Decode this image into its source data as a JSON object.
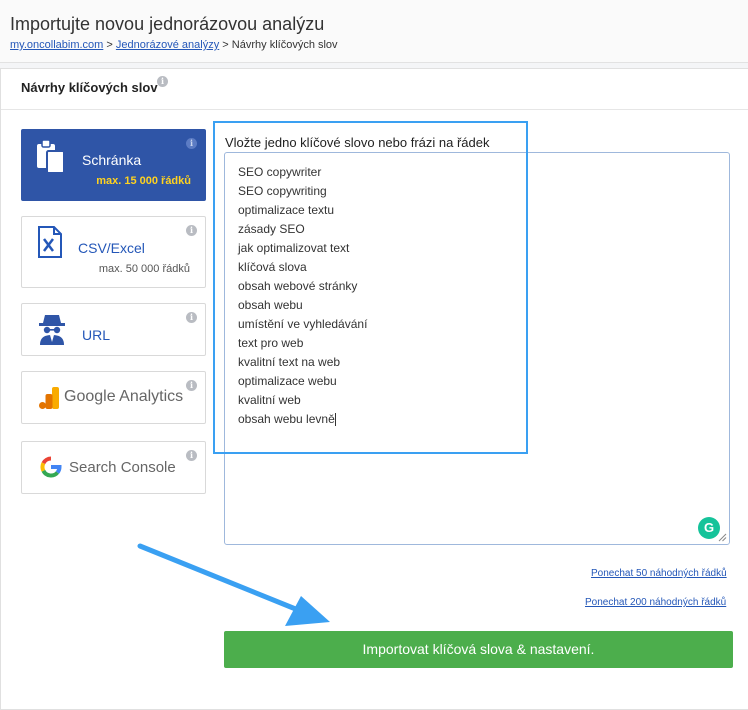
{
  "header": {
    "title": "Importujte novou jednorázovou analýzu",
    "breadcrumb": {
      "home": "my.oncollabim.com",
      "sep1": ">",
      "section": "Jednorázové analýzy",
      "sep2": ">",
      "current": "Návrhy klíčových slov"
    }
  },
  "panel": {
    "title": "Návrhy klíčových slov",
    "info_glyph": "i"
  },
  "sources": [
    {
      "icon": "clipboard-icon",
      "label": "Schránka",
      "sub": "max. 15 000 řádků",
      "active": true
    },
    {
      "icon": "excel-file-icon",
      "label": "CSV/Excel",
      "sub": "max. 50 000 řádků",
      "active": false
    },
    {
      "icon": "spy-icon",
      "label": "URL",
      "sub": "",
      "active": false
    },
    {
      "icon": "google-analytics-icon",
      "label": "Google Analytics",
      "sub": "",
      "active": false
    },
    {
      "icon": "google-icon",
      "label": "Search Console",
      "sub": "",
      "active": false
    }
  ],
  "textarea": {
    "label": "Vložte jedno klíčové slovo nebo frázi na řádek",
    "lines": [
      "SEO copywriter",
      "SEO copywriting",
      "optimalizace textu",
      "zásady SEO",
      "jak optimalizovat text",
      "klíčová slova",
      "obsah webové stránky",
      "obsah webu",
      "umístění ve vyhledávání",
      "text pro web",
      "kvalitní text na web",
      "optimalizace webu",
      "kvalitní web",
      "obsah webu levně"
    ]
  },
  "links": {
    "keep50": "Ponechat 50 náhodných řádků",
    "keep200": "Ponechat 200 náhodných řádků"
  },
  "import_button": "Importovat klíčová slova & nastavení.",
  "colors": {
    "active_source": "#2f55a7",
    "active_sub": "#ffd21f",
    "button": "#4cae4c",
    "highlight": "#3aa0f2"
  }
}
